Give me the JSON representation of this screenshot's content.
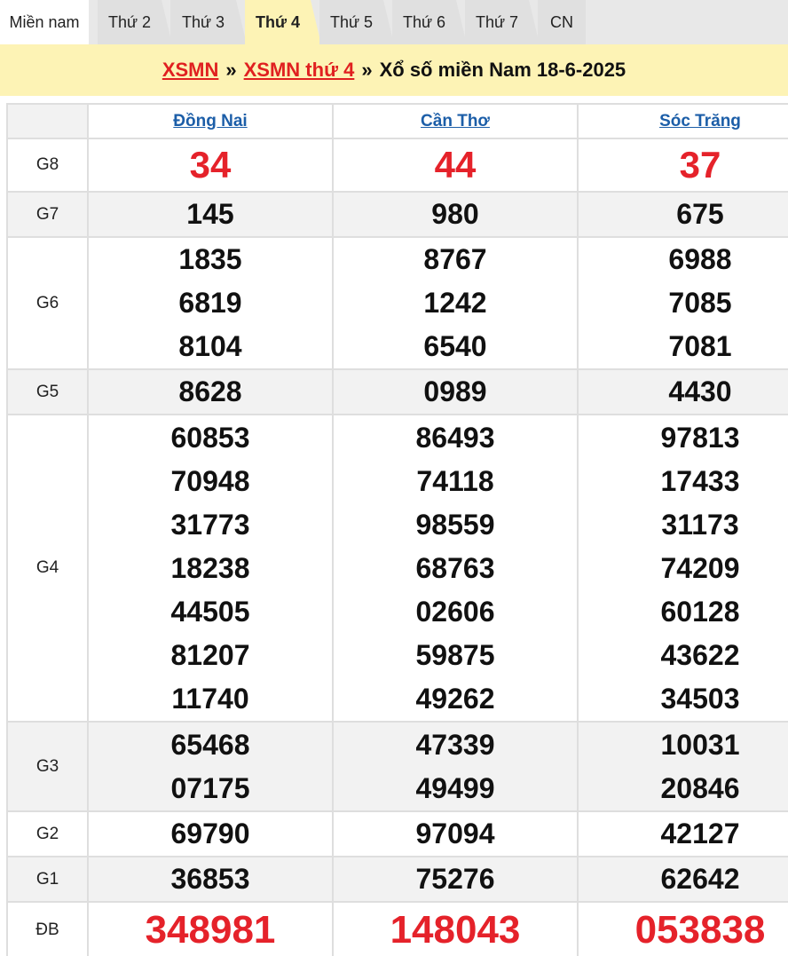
{
  "tabs": {
    "region": "Miền nam",
    "days": [
      "Thứ 2",
      "Thứ 3",
      "Thứ 4",
      "Thứ 5",
      "Thứ 6",
      "Thứ 7",
      "CN"
    ],
    "active": "Thứ 4"
  },
  "header": {
    "link1": "XSMN",
    "sep1": "»",
    "link2": "XSMN thứ 4",
    "sep2": "»",
    "title": "Xổ số miền Nam 18-6-2025"
  },
  "colors": {
    "accent_red": "#e5222a",
    "link_blue": "#1c5ea8",
    "header_bg": "#fdf3b5"
  },
  "provinces": [
    "Đồng Nai",
    "Cần Thơ",
    "Sóc Trăng"
  ],
  "prizes": {
    "g8": {
      "label": "G8",
      "values": [
        [
          "34"
        ],
        [
          "44"
        ],
        [
          "37"
        ]
      ]
    },
    "g7": {
      "label": "G7",
      "values": [
        [
          "145"
        ],
        [
          "980"
        ],
        [
          "675"
        ]
      ]
    },
    "g6": {
      "label": "G6",
      "values": [
        [
          "1835",
          "6819",
          "8104"
        ],
        [
          "8767",
          "1242",
          "6540"
        ],
        [
          "6988",
          "7085",
          "7081"
        ]
      ]
    },
    "g5": {
      "label": "G5",
      "values": [
        [
          "8628"
        ],
        [
          "0989"
        ],
        [
          "4430"
        ]
      ]
    },
    "g4": {
      "label": "G4",
      "values": [
        [
          "60853",
          "70948",
          "31773",
          "18238",
          "44505",
          "81207",
          "11740"
        ],
        [
          "86493",
          "74118",
          "98559",
          "68763",
          "02606",
          "59875",
          "49262"
        ],
        [
          "97813",
          "17433",
          "31173",
          "74209",
          "60128",
          "43622",
          "34503"
        ]
      ]
    },
    "g3": {
      "label": "G3",
      "values": [
        [
          "65468",
          "07175"
        ],
        [
          "47339",
          "49499"
        ],
        [
          "10031",
          "20846"
        ]
      ]
    },
    "g2": {
      "label": "G2",
      "values": [
        [
          "69790"
        ],
        [
          "97094"
        ],
        [
          "42127"
        ]
      ]
    },
    "g1": {
      "label": "G1",
      "values": [
        [
          "36853"
        ],
        [
          "75276"
        ],
        [
          "62642"
        ]
      ]
    },
    "db": {
      "label": "ĐB",
      "values": [
        [
          "348981"
        ],
        [
          "148043"
        ],
        [
          "053838"
        ]
      ]
    }
  }
}
